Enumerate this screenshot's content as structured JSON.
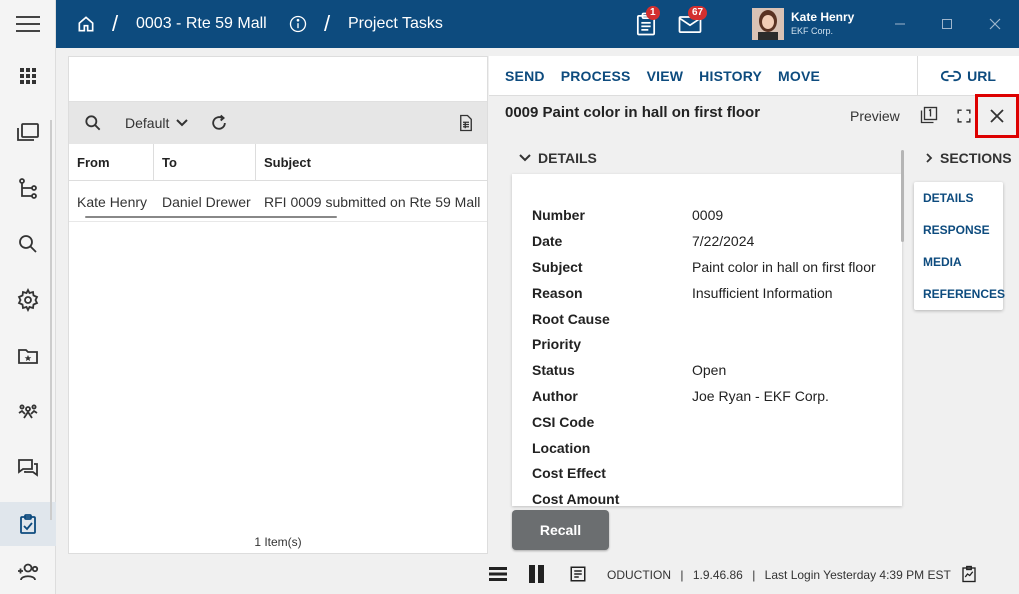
{
  "topbar": {
    "project": "0003 - Rte 59 Mall",
    "page": "Project Tasks",
    "separator": "/",
    "tasks_badge": "1",
    "mail_badge": "67",
    "user_name": "Kate Henry",
    "user_company": "EKF Corp."
  },
  "left_panel": {
    "view_name": "Default",
    "columns": [
      "From",
      "To",
      "Subject"
    ],
    "rows": [
      {
        "from": "Kate Henry",
        "to": "Daniel Drewer",
        "subject": "RFI 0009 submitted on Rte 59 Mall"
      }
    ],
    "footer": "1 Item(s)"
  },
  "right_toolbar": {
    "send": "SEND",
    "process": "PROCESS",
    "view": "VIEW",
    "history": "HISTORY",
    "move": "MOVE",
    "url": "URL"
  },
  "detail": {
    "title": "0009 Paint color in hall on first floor",
    "preview_label": "Preview",
    "details_header": "DETAILS",
    "sections_header": "SECTIONS",
    "fields": [
      {
        "label": "Number",
        "value": "0009"
      },
      {
        "label": "Date",
        "value": "7/22/2024"
      },
      {
        "label": "Subject",
        "value": "Paint color in hall on first floor"
      },
      {
        "label": "Reason",
        "value": "Insufficient Information"
      },
      {
        "label": "Root Cause",
        "value": ""
      },
      {
        "label": "Priority",
        "value": ""
      },
      {
        "label": "Status",
        "value": "Open"
      },
      {
        "label": "Author",
        "value": "Joe Ryan - EKF Corp."
      },
      {
        "label": "CSI Code",
        "value": ""
      },
      {
        "label": "Location",
        "value": ""
      },
      {
        "label": "Cost Effect",
        "value": ""
      },
      {
        "label": "Cost Amount",
        "value": ""
      }
    ],
    "sections": [
      "DETAILS",
      "RESPONSE",
      "MEDIA",
      "REFERENCES"
    ],
    "recall_label": "Recall"
  },
  "status": {
    "environment": "ODUCTION",
    "version": "1.9.46.86",
    "last_login": "Last Login Yesterday 4:39 PM EST",
    "divider": "|"
  },
  "colors": {
    "brand": "#0d4b7e",
    "badge": "#d32f2f",
    "highlight": "#dd0000"
  }
}
